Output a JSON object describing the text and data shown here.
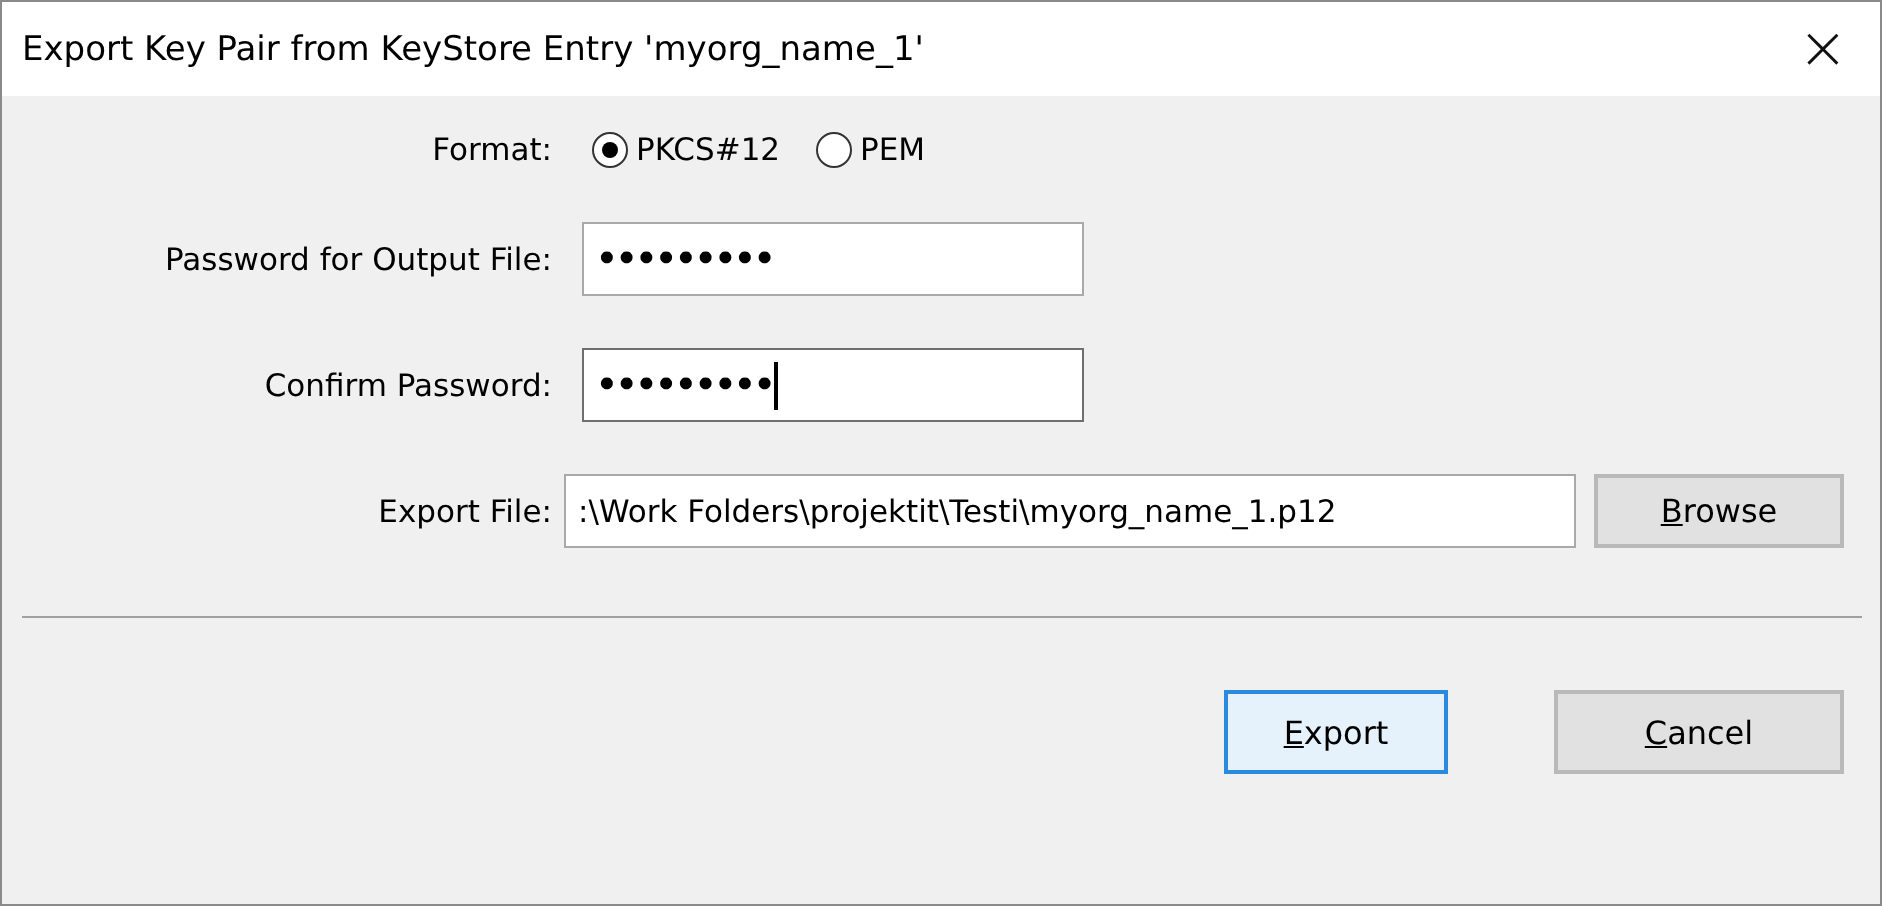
{
  "window": {
    "title": "Export Key Pair from KeyStore Entry 'myorg_name_1'",
    "close": "×"
  },
  "format": {
    "label": "Format:",
    "options": [
      {
        "label": "PKCS#12",
        "selected": true
      },
      {
        "label": "PEM",
        "selected": false
      }
    ]
  },
  "fields": [
    {
      "label": "Password for Output File:",
      "value": "•••••••••",
      "focused": false
    },
    {
      "label": "Confirm Password:",
      "value": "•••••••••",
      "focused": true
    }
  ],
  "export_file": {
    "label": "Export File:",
    "value": ":\\Work Folders\\projektit\\Testi\\myorg_name_1.p12",
    "button": "Browse"
  },
  "buttons": [
    {
      "label": "Export",
      "default": true
    },
    {
      "label": "Cancel",
      "default": false
    }
  ]
}
